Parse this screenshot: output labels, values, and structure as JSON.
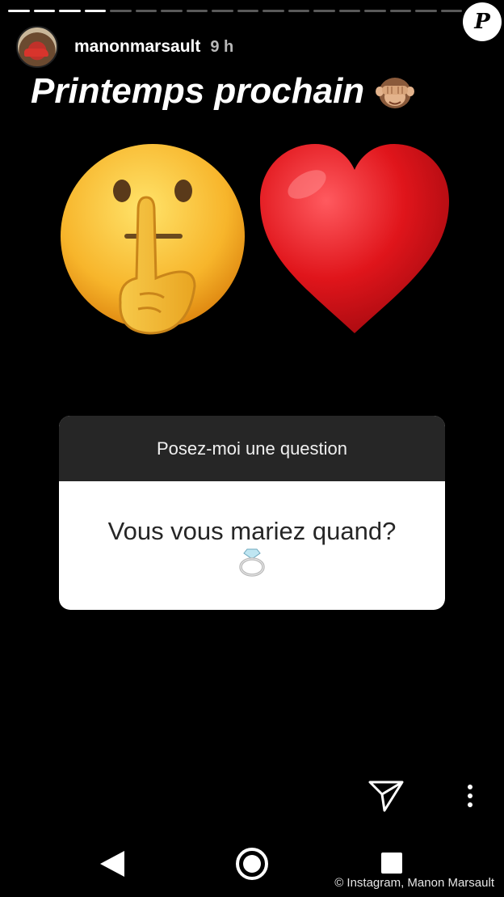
{
  "story": {
    "progress": {
      "segments_total": 18,
      "segments_done": 4
    },
    "username": "manonmarsault",
    "time_ago": "9 h",
    "headline": "Printemps prochain",
    "headline_emoji": "see-no-evil-monkey",
    "stickers": [
      "shushing-face-emoji",
      "red-heart-emoji"
    ],
    "question_card": {
      "header": "Posez-moi une question",
      "question": "Vous vous mariez quand?",
      "emoji": "ring"
    },
    "actions": {
      "send_icon": "paper-plane-icon",
      "more_icon": "more-vertical-icon"
    }
  },
  "watermark": {
    "logo_letter": "P"
  },
  "system_nav": [
    "back-icon",
    "home-icon",
    "recent-apps-icon"
  ],
  "credit": "© Instagram, Manon Marsault",
  "colors": {
    "background": "#000000",
    "card_header": "#262626",
    "card_body": "#ffffff",
    "heart": "#e0151b"
  }
}
